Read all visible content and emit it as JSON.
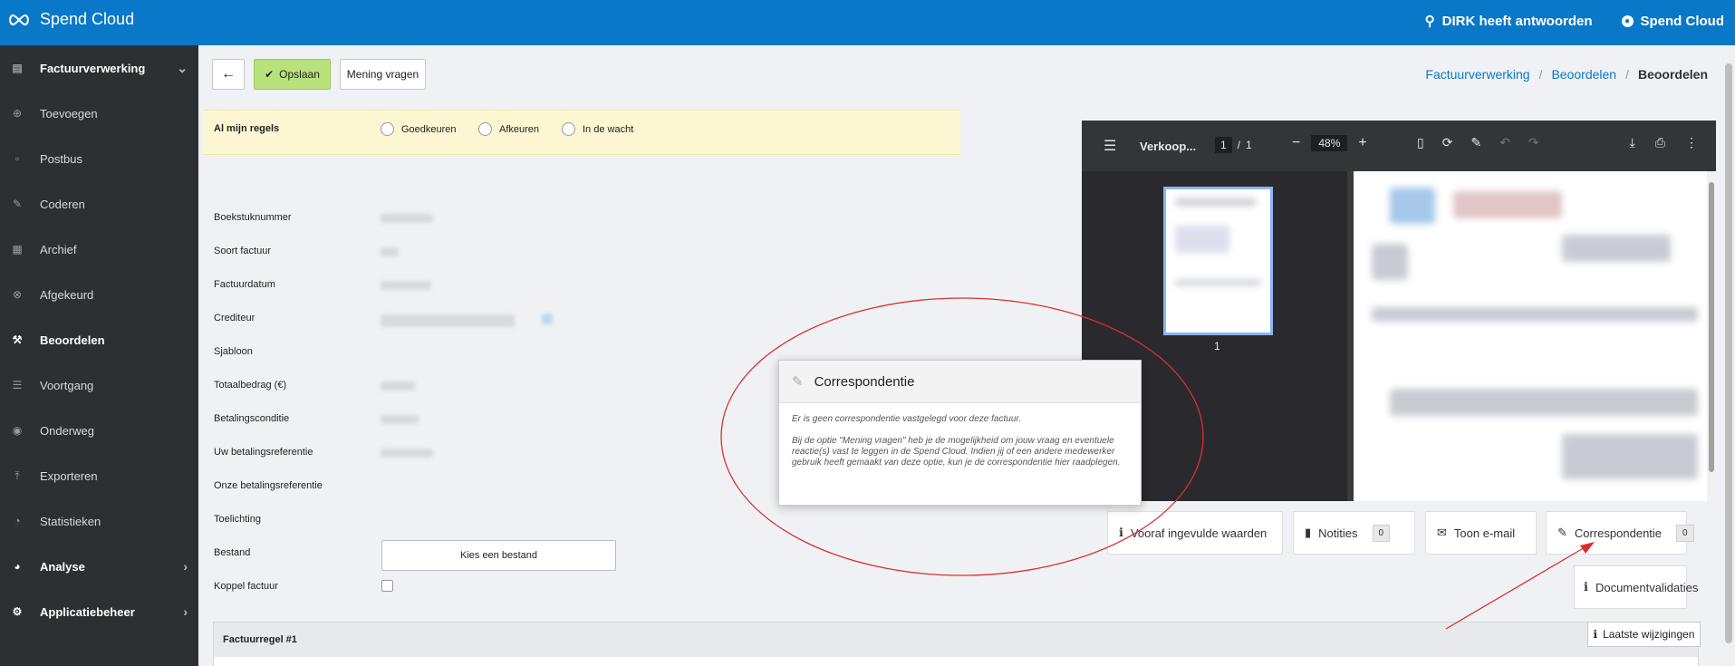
{
  "topbar": {
    "brand": "Spend Cloud",
    "help": "DIRK heeft antwoorden",
    "user": "Spend Cloud"
  },
  "sidebar": {
    "items": [
      {
        "label": "Factuurverwerking",
        "icon": "file-icon"
      },
      {
        "label": "Toevoegen",
        "icon": "plus-circle-icon"
      },
      {
        "label": "Postbus",
        "icon": "inbox-icon"
      },
      {
        "label": "Coderen",
        "icon": "pencil-icon"
      },
      {
        "label": "Archief",
        "icon": "archive-icon"
      },
      {
        "label": "Afgekeurd",
        "icon": "x-circle-icon"
      },
      {
        "label": "Beoordelen",
        "icon": "gavel-icon"
      },
      {
        "label": "Voortgang",
        "icon": "list-icon"
      },
      {
        "label": "Onderweg",
        "icon": "binoculars-icon"
      },
      {
        "label": "Exporteren",
        "icon": "upload-icon"
      },
      {
        "label": "Statistieken",
        "icon": "pie-icon"
      },
      {
        "label": "Analyse",
        "icon": "pie-chart-icon"
      },
      {
        "label": "Applicatiebeheer",
        "icon": "gear-icon"
      }
    ]
  },
  "toolbar": {
    "save_label": "Opslaan",
    "opinion_label": "Mening vragen"
  },
  "breadcrumb": {
    "items": [
      "Factuurverwerking",
      "Beoordelen"
    ],
    "current": "Beoordelen"
  },
  "rules": {
    "label": "Al mijn regels",
    "options": [
      "Goedkeuren",
      "Afkeuren",
      "In de wacht"
    ]
  },
  "form": {
    "fields": [
      "Boekstuknummer",
      "Soort factuur",
      "Factuurdatum",
      "Crediteur",
      "Sjabloon",
      "Totaalbedrag (€)",
      "Betalingsconditie",
      "Uw betalingsreferentie",
      "Onze betalingsreferentie",
      "Toelichting",
      "Bestand",
      "Koppel factuur"
    ],
    "file_button": "Kies een bestand"
  },
  "pdf": {
    "name": "Verkoop...",
    "page": "1",
    "total": "1",
    "zoom": "48%",
    "thumb_label": "1"
  },
  "actions": {
    "prefilled": "Vooraf ingevulde waarden",
    "notes": "Notities",
    "notes_count": "0",
    "email": "Toon e-mail",
    "correspondence": "Correspondentie",
    "correspondence_count": "0",
    "validations": "Documentvalidaties",
    "last_changes": "Laatste wijzigingen"
  },
  "popover": {
    "title": "Correspondentie",
    "line1": "Er is geen correspondentie vastgelegd voor deze factuur.",
    "line2": "Bij de optie \"Mening vragen\" heb je de mogelijkheid om jouw vraag en eventuele reactie(s) vast te leggen in de Spend Cloud. Indien jij of een andere medewerker gebruik heeft gemaakt van deze optie, kun je de correspondentie hier raadplegen."
  },
  "section": {
    "title": "Factuurregel #1"
  },
  "colors": {
    "brand": "#0a78c8",
    "sidebar": "#2d3033",
    "save": "#b9e27a",
    "highlight": "#fdf6d2",
    "annotation": "#d9302f"
  }
}
